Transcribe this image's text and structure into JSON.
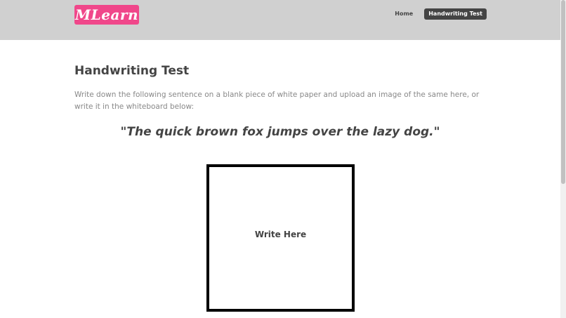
{
  "header": {
    "logo_text": "MLearn",
    "nav": {
      "home_label": "Home",
      "handwriting_test_label": "Handwriting Test"
    }
  },
  "main": {
    "title": "Handwriting Test",
    "instructions": "Write down the following sentence on a blank piece of white paper and upload an image of the same here, or write it in the whiteboard below:",
    "sentence": "\"The quick brown fox jumps over the lazy dog.\"",
    "whiteboard_label": "Write Here"
  },
  "colors": {
    "brand": "#f0478a",
    "header_bg": "#d0d0d0",
    "text_dark": "#444444",
    "text_muted": "#888888"
  }
}
